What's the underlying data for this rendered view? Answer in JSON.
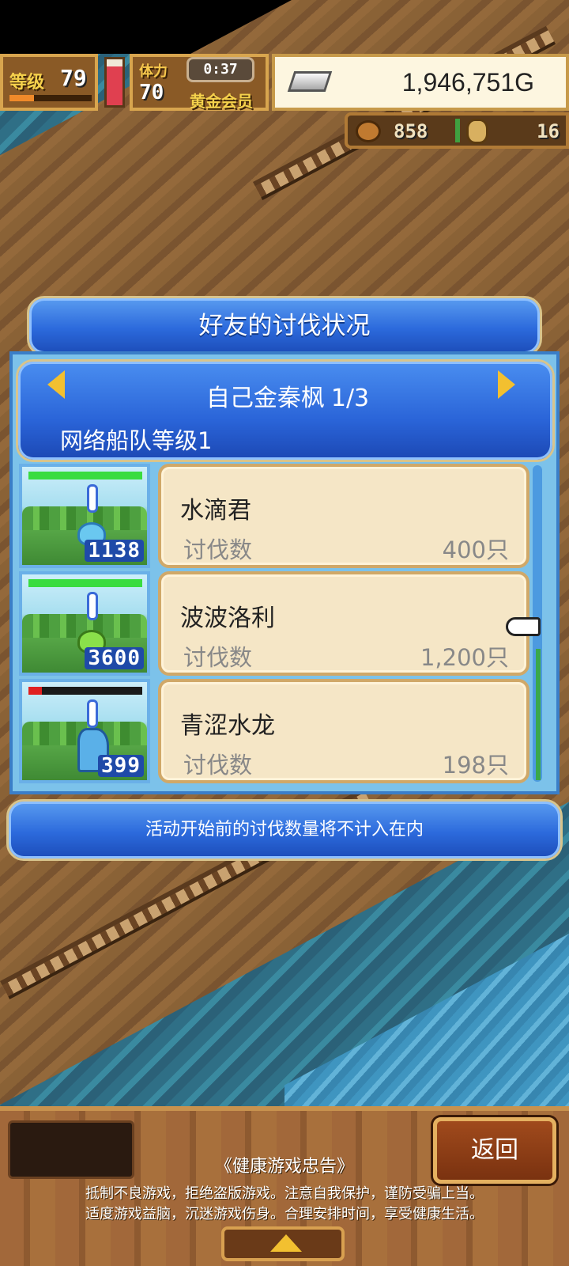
{
  "hud": {
    "level_label": "等级",
    "level_value": "79",
    "level_progress": 0.3,
    "stamina_label": "体力",
    "stamina_value": "70",
    "stamina_fill": 0.85,
    "timer": "0:37",
    "membership": "黄金会员",
    "money": "1,946,751G",
    "coins": "858",
    "medals": "16"
  },
  "dialog": {
    "title": "好友的讨伐状况",
    "friend_name": "自己金秦枫",
    "page": "1/3",
    "fleet_level": "网络船队等级1",
    "kill_label": "讨伐数",
    "monsters": [
      {
        "name": "水滴君",
        "kills": "400只",
        "thumb_count": "1138",
        "hp": 1.0,
        "type": "water"
      },
      {
        "name": "波波洛利",
        "kills": "1,200只",
        "thumb_count": "3600",
        "hp": 1.0,
        "type": "slime"
      },
      {
        "name": "青涩水龙",
        "kills": "198只",
        "thumb_count": "399",
        "hp": 0.12,
        "type": "dragon"
      }
    ],
    "notice": "活动开始前的讨伐数量将不计入在内"
  },
  "bottom": {
    "back_label": "返回",
    "health_title": "《健康游戏忠告》",
    "health_line_1": "抵制不良游戏，拒绝盗版游戏。注意自我保护，谨防受骗上当。",
    "health_line_2": "适度游戏益脑，沉迷游戏伤身。合理安排时间，享受健康生活。"
  },
  "colors": {
    "panel_blue": "#2c6adc",
    "card_beige": "#f5e6c6",
    "gold_accent": "#f2c030"
  }
}
